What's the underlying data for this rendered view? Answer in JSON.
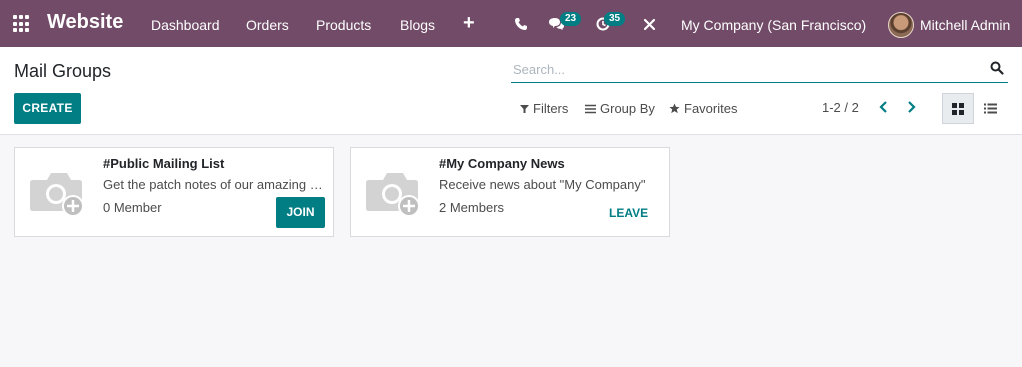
{
  "navbar": {
    "brand": "Website",
    "menu": [
      "Dashboard",
      "Orders",
      "Products",
      "Blogs"
    ],
    "messages_count": "23",
    "activities_count": "35",
    "company": "My Company (San Francisco)",
    "user": "Mitchell Admin"
  },
  "control": {
    "title": "Mail Groups",
    "search_placeholder": "Search...",
    "create_label": "CREATE",
    "filters_label": "Filters",
    "groupby_label": "Group By",
    "favorites_label": "Favorites",
    "pager": "1-2 / 2"
  },
  "cards": [
    {
      "title": "#Public Mailing List",
      "description": "Get the patch notes of our amazing products",
      "members": "0 Member",
      "action": "JOIN"
    },
    {
      "title": "#My Company News",
      "description": "Receive news about \"My Company\"",
      "members": "2 Members",
      "action": "LEAVE"
    }
  ],
  "colors": {
    "navbar": "#714b67",
    "primary": "#017e84",
    "background": "#f7f7fa"
  }
}
